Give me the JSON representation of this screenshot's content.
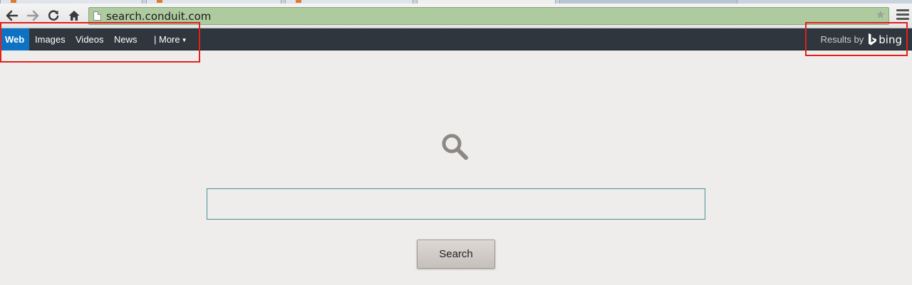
{
  "browser": {
    "url": "search.conduit.com"
  },
  "nav": {
    "items": [
      {
        "label": "Web",
        "active": true
      },
      {
        "label": "Images",
        "active": false
      },
      {
        "label": "Videos",
        "active": false
      },
      {
        "label": "News",
        "active": false
      }
    ],
    "more_label": "| More",
    "results_by": "Results by",
    "bing": "bing"
  },
  "search": {
    "input_value": "",
    "button_label": "Search"
  },
  "colors": {
    "nav_bg": "#2f363d",
    "active_tab": "#0e72c4",
    "annotation": "#e2201c",
    "omnibox": "#aecb9f",
    "page_bg": "#efedeb"
  }
}
